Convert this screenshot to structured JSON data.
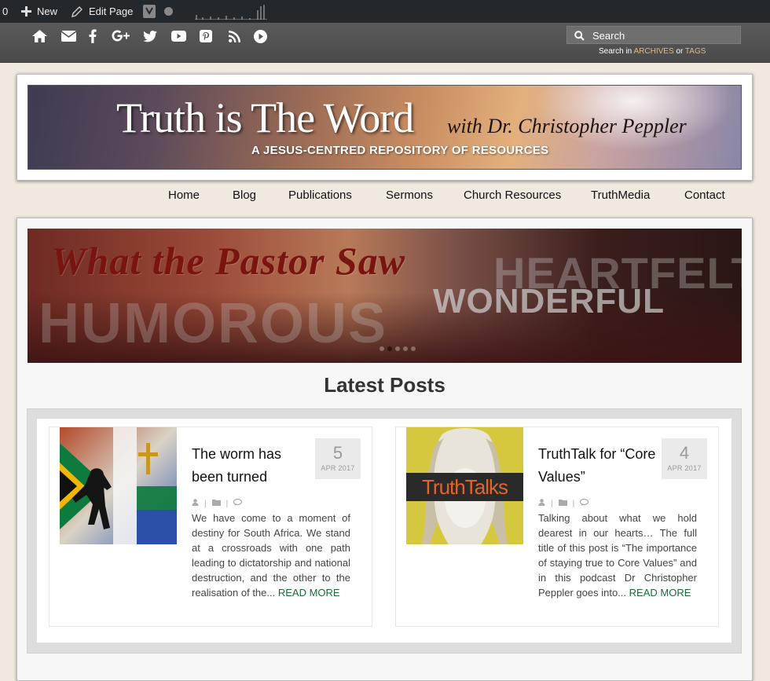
{
  "adminbar": {
    "counter": "0",
    "new_label": "New",
    "edit_label": "Edit Page"
  },
  "social": {
    "icons": [
      "home-icon",
      "email-icon",
      "facebook-icon",
      "google-plus-icon",
      "twitter-icon",
      "youtube-icon",
      "pinterest-icon",
      "rss-icon",
      "play-icon"
    ],
    "search_placeholder": "Search",
    "search_hint_prefix": "Search in",
    "archives": "ARCHIVES",
    "or": "or",
    "tags": "TAGS"
  },
  "header": {
    "title": "Truth is The Word",
    "subtitle": "with Dr. Christopher Peppler",
    "tagline": "A JESUS-CENTRED REPOSITORY OF RESOURCES"
  },
  "nav": {
    "items": [
      "Home",
      "Blog",
      "Publications",
      "Sermons",
      "Church Resources",
      "TruthMedia",
      "Contact"
    ]
  },
  "slider": {
    "title": "What the Pastor Saw",
    "words": [
      "HEARTFELT",
      "WONDERFUL",
      "HUMOROUS"
    ]
  },
  "latest": {
    "heading": "Latest Posts",
    "posts": [
      {
        "title": "The worm has been turned",
        "day": "5",
        "month": "APR 2017",
        "excerpt": "We have come to a moment of destiny for South Africa. We stand at a crossroads with one path leading to dictatorship and national destruction, and the other to the realisation of the...",
        "read_more": "READ MORE"
      },
      {
        "title": "TruthTalk for “Core Values”",
        "day": "4",
        "month": "APR 2017",
        "thumb_label": "TruthTalks",
        "excerpt": "Talking about what we hold dearest in our hearts… The full title of this post is “The importance of staying true to Core Values” and in this podcast Dr Christopher Peppler goes into...",
        "read_more": "READ MORE"
      }
    ]
  },
  "colors": {
    "adminbar": "#23282d",
    "socialbar": "#4f4f4f",
    "accent_link": "#1a6b3a",
    "hint_link": "#e0b98a"
  }
}
